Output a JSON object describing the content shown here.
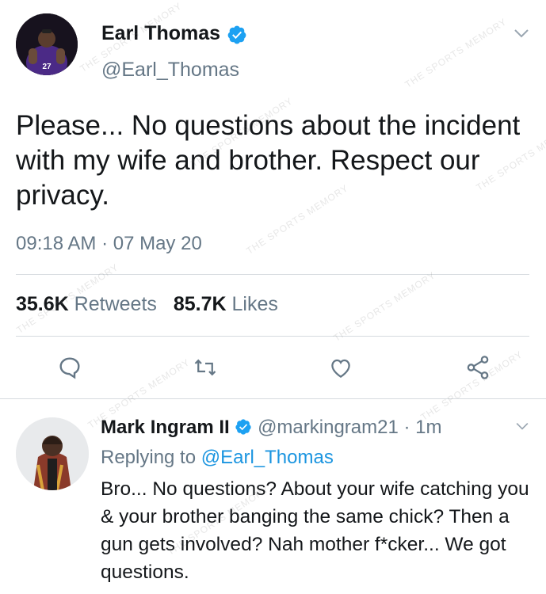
{
  "tweet": {
    "author_name": "Earl Thomas",
    "author_handle": "@Earl_Thomas",
    "text": "Please... No questions about the incident with my wife and brother. Respect our privacy.",
    "timestamp": "09:18 AM · 07 May 20",
    "retweets_count": "35.6K",
    "retweets_label": "Retweets",
    "likes_count": "85.7K",
    "likes_label": "Likes",
    "avatar_jersey_number": "27"
  },
  "actions": [
    {
      "name": "reply",
      "icon": "comment-icon"
    },
    {
      "name": "retweet",
      "icon": "retweet-icon"
    },
    {
      "name": "like",
      "icon": "heart-icon"
    },
    {
      "name": "share",
      "icon": "share-icon"
    }
  ],
  "reply": {
    "author_name": "Mark Ingram II",
    "author_handle": "@markingram21",
    "separator": "·",
    "time": "1m",
    "replying_prefix": "Replying to",
    "replying_to": "@Earl_Thomas",
    "text": "Bro... No questions? About your wife catching you & your brother banging the same chick? Then a gun gets involved? Nah mother f*cker... We got questions."
  },
  "watermark": "THE SPORTS MEMORY",
  "colors": {
    "verified": "#1da1f2",
    "mention": "#1b95e0",
    "secondary_text": "#657786",
    "divider": "#d6dbdf"
  }
}
